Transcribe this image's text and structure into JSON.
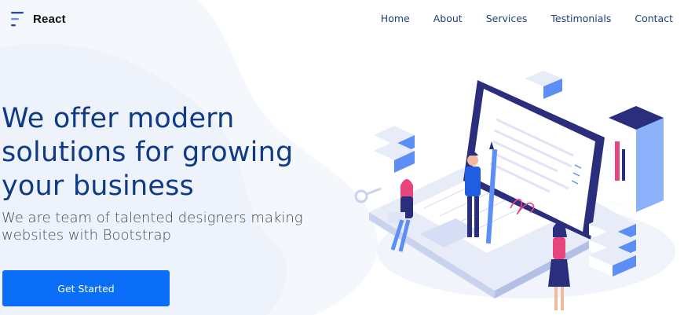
{
  "header": {
    "brand": "React",
    "brand_icon": "menu-lines-icon",
    "nav": [
      "Home",
      "About",
      "Services",
      "Testimonials",
      "Contact"
    ]
  },
  "hero": {
    "title_lines": [
      "We offer modern",
      "solutions for growing",
      "your business"
    ],
    "subtitle_lines": [
      "We are team of talented designers making",
      "websites with Bootstrap"
    ],
    "cta_label": "Get Started"
  },
  "illustration": {
    "icon": "laptop-team-illustration"
  },
  "colors": {
    "accent": "#0b6ef8",
    "title": "#0e3a86",
    "nav": "#1f3f73",
    "illustration_dark": "#2b2e7c",
    "illustration_blue": "#5d8ef5",
    "illustration_pink": "#e8457d"
  }
}
